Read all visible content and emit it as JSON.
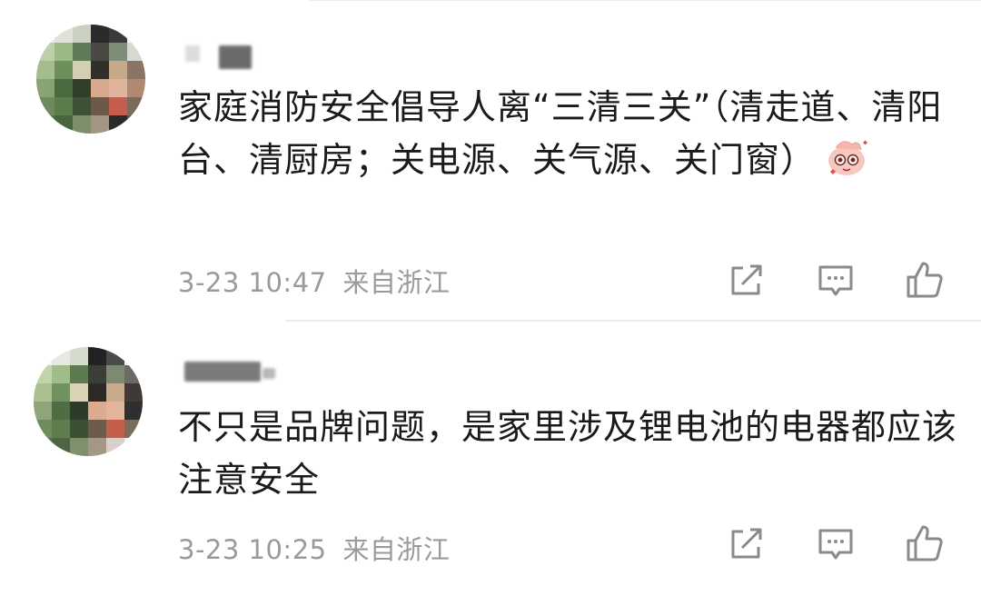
{
  "comments": [
    {
      "text": "家庭消防安全倡导人离“三清三关”（清走道、清阳台、清厨房；关电源、关气源、关门窗）",
      "has_emoji": true,
      "time": "3-23 10:47",
      "location": "来自浙江"
    },
    {
      "text": "不只是品牌问题，是家里涉及锂电池的电器都应该注意安全",
      "has_emoji": false,
      "time": "3-23 10:25",
      "location": "来自浙江"
    }
  ],
  "icons": {
    "share": "share-icon",
    "reply": "comment-icon",
    "like": "thumbs-up-icon"
  },
  "colors": {
    "meta_text": "#9a9a9a",
    "body_text": "#1a1a1a",
    "icon": "#8a8a8a"
  }
}
